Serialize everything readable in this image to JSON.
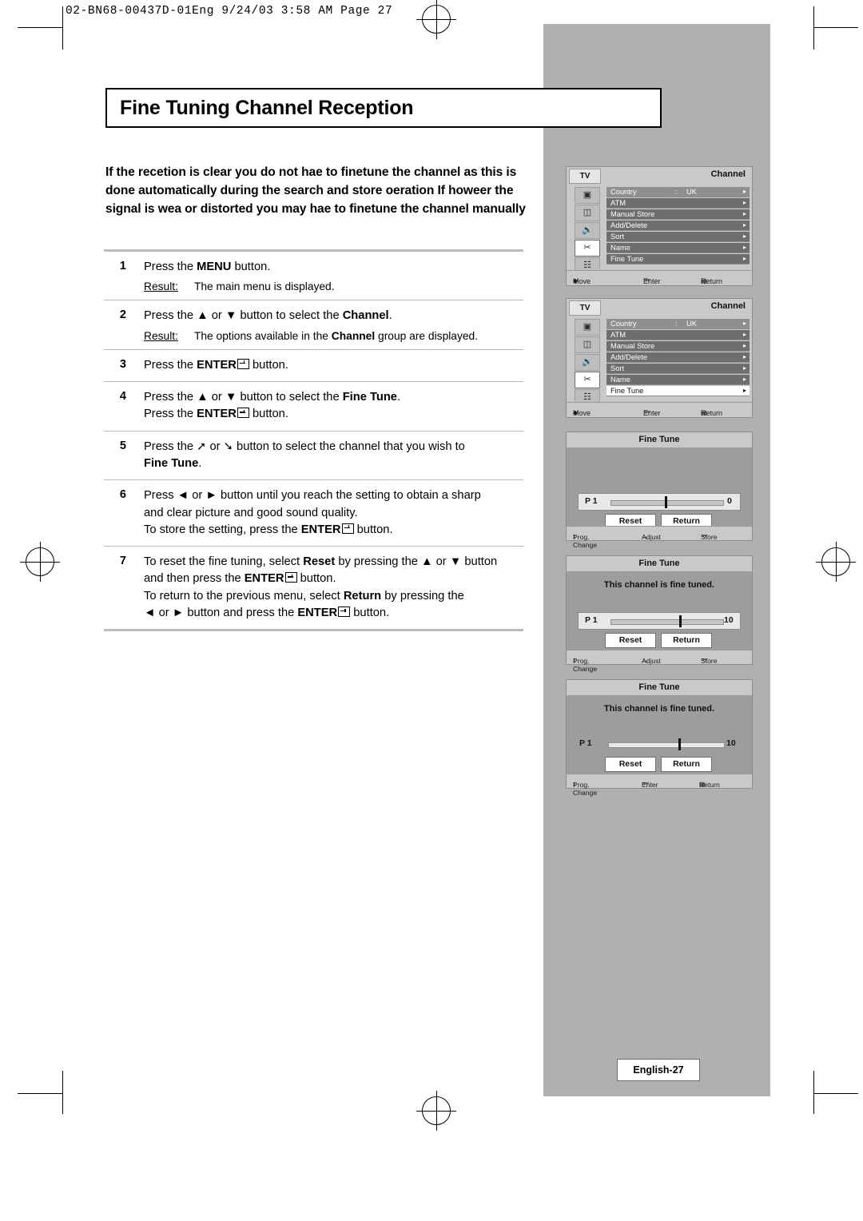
{
  "slug": "02-BN68-00437D-01Eng  9/24/03 3:58 AM  Page 27",
  "title": "Fine Tuning Channel Reception",
  "intro": "If the recetion is clear you do not hae to finetune the channel as this is done automatically during the search and store oeration If howeer the signal is wea or distorted you may hae to finetune the channel manually",
  "steps": [
    {
      "num": "1",
      "lines": [
        "Press the MENU button."
      ],
      "result_label": "Result:",
      "result_text": "The main menu is displayed."
    },
    {
      "num": "2",
      "lines": [
        "Press the ▲ or ▼ button to select the Channel."
      ],
      "result_label": "Result:",
      "result_text": "The options available in the Channel group are displayed."
    },
    {
      "num": "3",
      "lines": [
        "Press the ENTER button."
      ]
    },
    {
      "num": "4",
      "lines": [
        "Press the ▲ or ▼ button to select the Fine Tune.",
        "Press the ENTER button."
      ]
    },
    {
      "num": "5",
      "lines": [
        "Press the ↖ or ↘ button to select the channel that you wish to Fine Tune."
      ]
    },
    {
      "num": "6",
      "lines": [
        "Press ◄ or ► button until you reach the setting to obtain a sharp and clear picture and good sound quality.",
        "To store the setting, press the ENTER button."
      ]
    },
    {
      "num": "7",
      "lines": [
        "To reset the fine tuning, select Reset by pressing the ▲ or ▼ button and then press the ENTER button.",
        "To return to the previous menu, select Return by pressing the ◄ or ► button and press the ENTER button."
      ]
    }
  ],
  "osd": {
    "tv_label": "TV",
    "channel_title": "Channel",
    "icons": [
      "picture-icon",
      "channel-icon",
      "sound-icon",
      "setup-icon",
      "pip-icon"
    ],
    "menu_items": [
      {
        "label": "Country",
        "colon": ":",
        "value": "UK",
        "arrow": "▸"
      },
      {
        "label": "ATM",
        "colon": "",
        "value": "",
        "arrow": "▸"
      },
      {
        "label": "Manual Store",
        "colon": "",
        "value": "",
        "arrow": "▸"
      },
      {
        "label": "Add/Delete",
        "colon": "",
        "value": "",
        "arrow": "▸"
      },
      {
        "label": "Sort",
        "colon": "",
        "value": "",
        "arrow": "▸"
      },
      {
        "label": "Name",
        "colon": "",
        "value": "",
        "arrow": "▸"
      },
      {
        "label": "Fine Tune",
        "colon": "",
        "value": "",
        "arrow": "▸"
      }
    ],
    "footer": {
      "move": "Move",
      "enter": "Enter",
      "return": "Return",
      "prog_change": "Prog. Change",
      "adjust": "Adjust",
      "store": "Store"
    }
  },
  "fine_tune": {
    "title": "Fine Tune",
    "tuned_message": "This channel is fine tuned.",
    "prog_label": "P 1",
    "reset_label": "Reset",
    "return_label": "Return",
    "values": {
      "panel1": "0",
      "panel2": "10",
      "panel3": "10"
    }
  },
  "page_footer": "English-27"
}
